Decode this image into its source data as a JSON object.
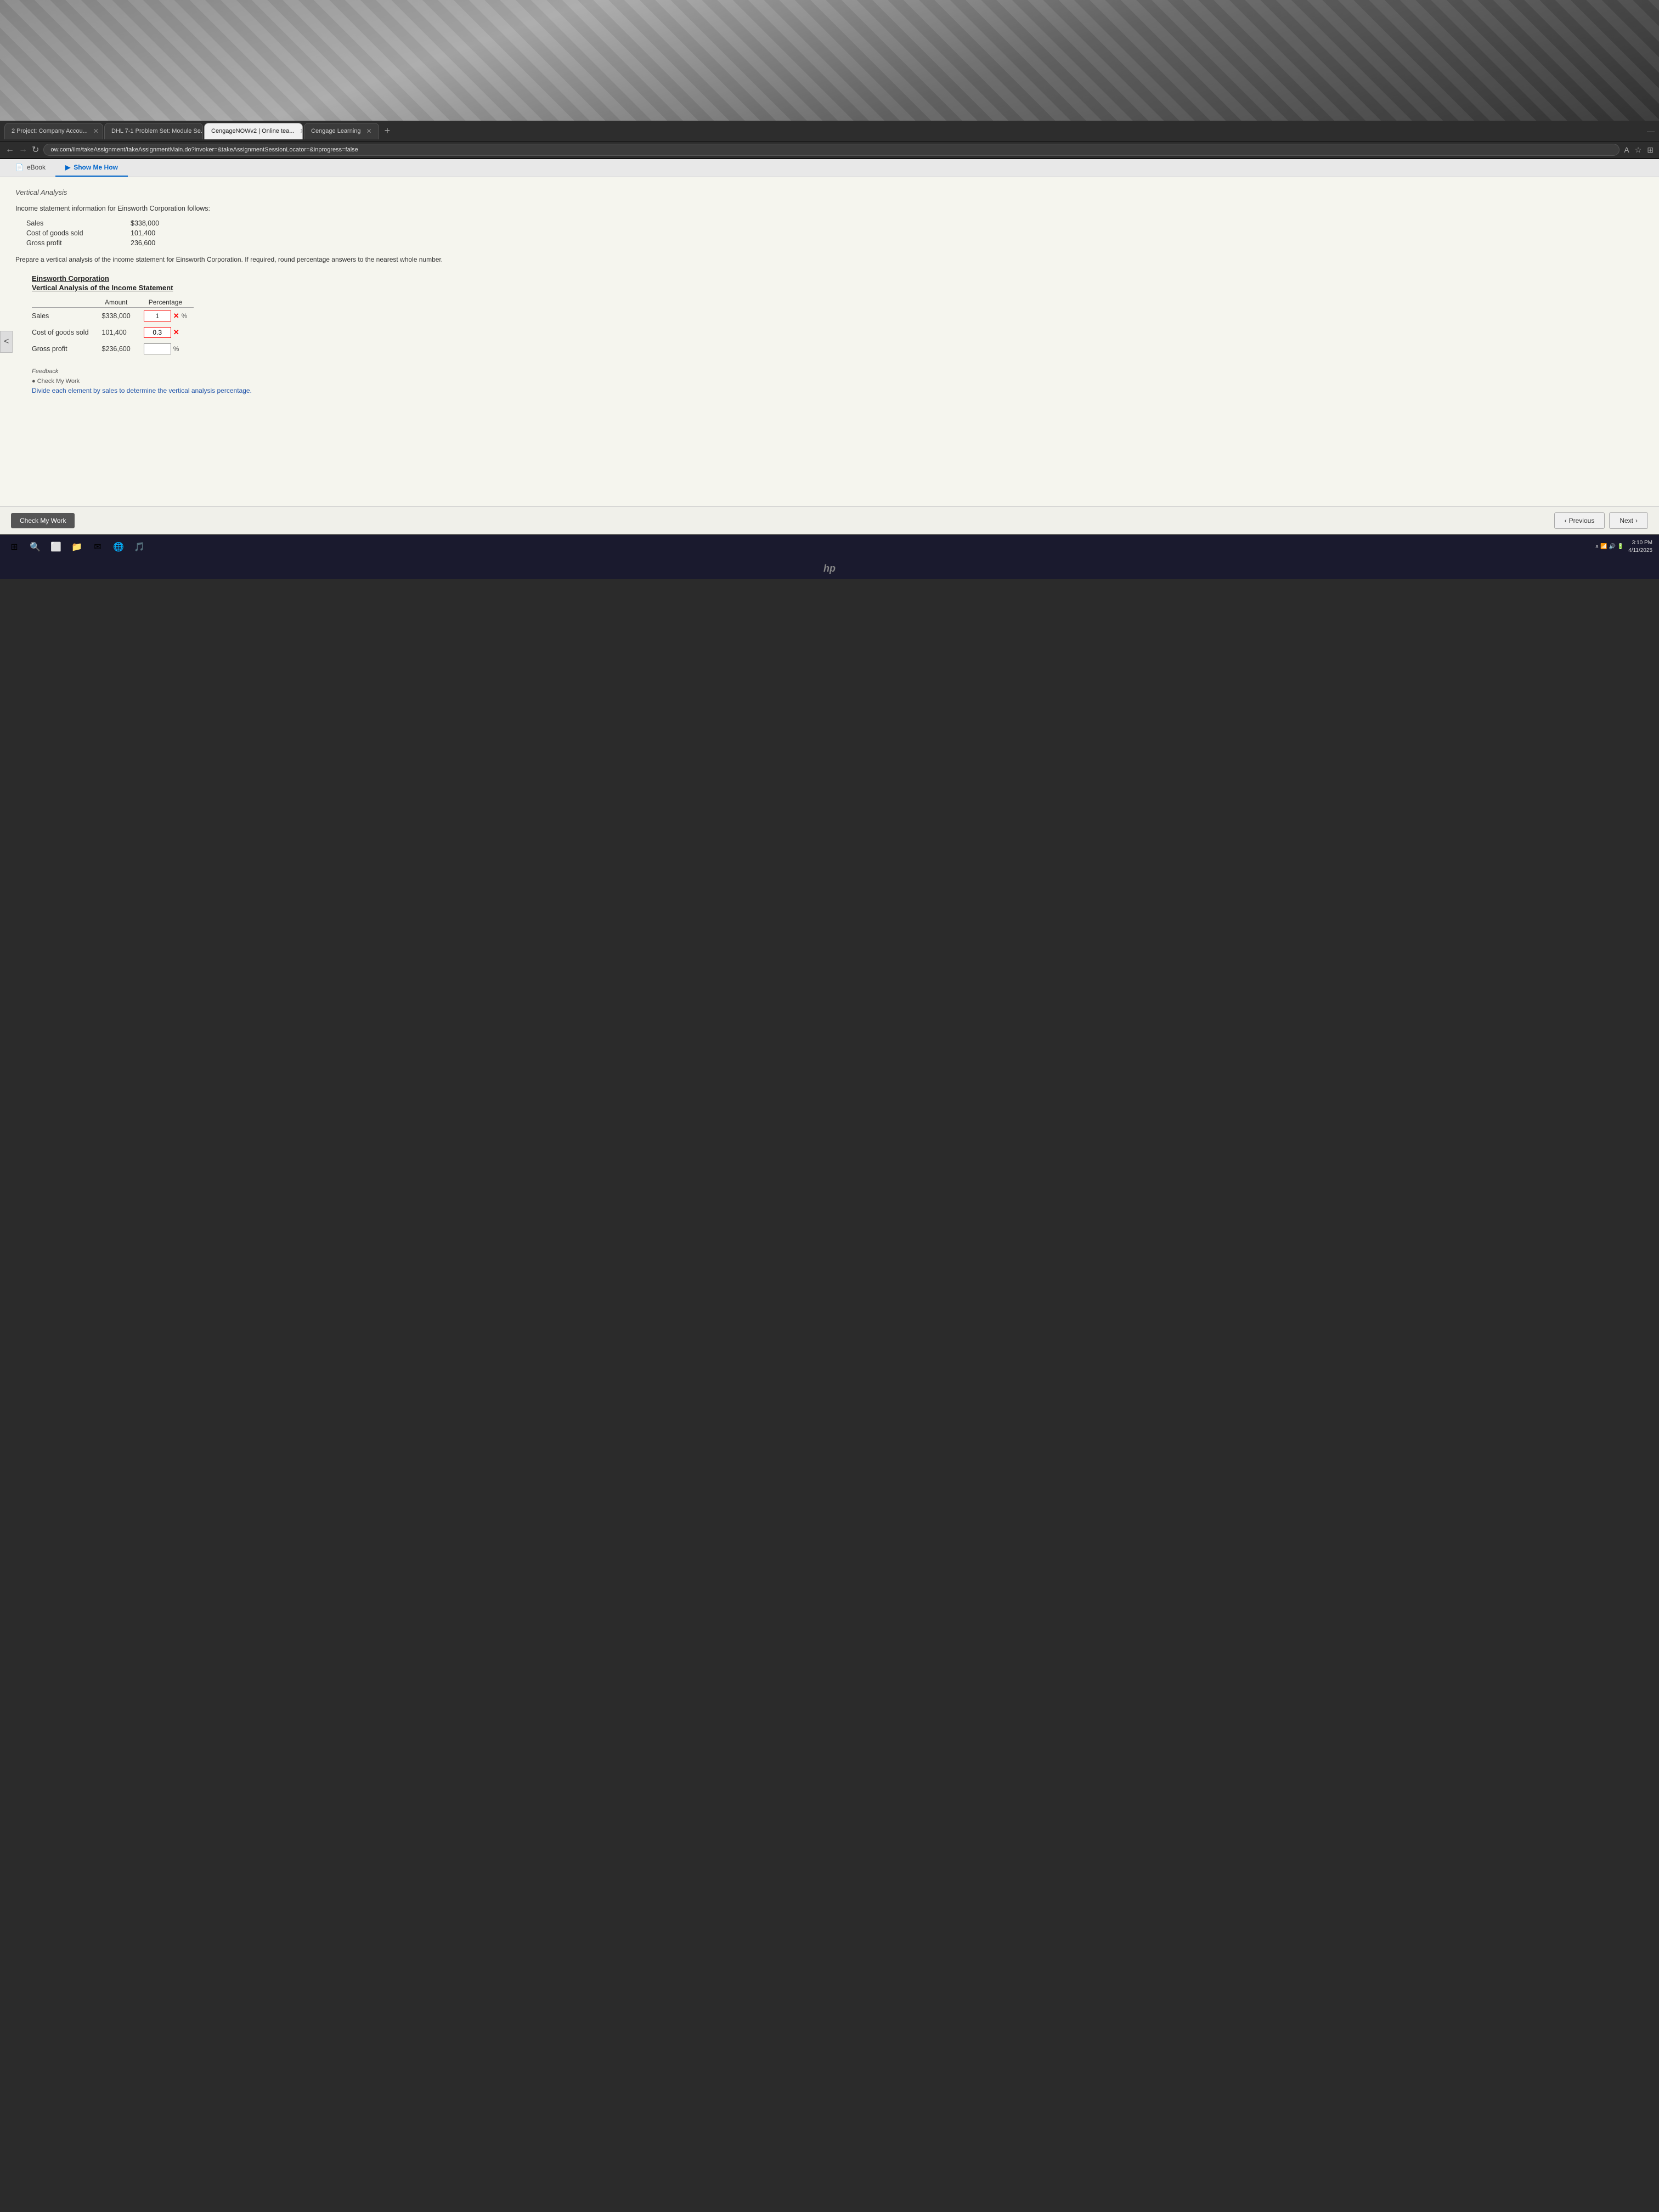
{
  "wallpaper": {
    "alt": "Plaid blanket background"
  },
  "tabs": [
    {
      "id": "tab-project",
      "label": "2 Project: Company Accou...",
      "active": false
    },
    {
      "id": "tab-problem",
      "label": "DHL 7-1 Problem Set: Module Se...",
      "active": false
    },
    {
      "id": "tab-cnow",
      "label": "CengageNOWv2 | Online tea...",
      "active": true
    },
    {
      "id": "tab-cengage",
      "label": "Cengage Learning",
      "active": false
    }
  ],
  "address_bar": {
    "url": "ow.com/ilm/takeAssignment/takeAssignmentMain.do?invoker=&takeAssignmentSessionLocator=&inprogress=false"
  },
  "content_tabs": [
    {
      "id": "ebook-tab",
      "label": "eBook",
      "icon": "📄",
      "active": false
    },
    {
      "id": "show-me-how-tab",
      "label": "Show Me How",
      "icon": "▶",
      "active": true
    }
  ],
  "section": {
    "title": "Vertical Analysis",
    "description": "Income statement information for Einsworth Corporation follows:",
    "data_rows": [
      {
        "label": "Sales",
        "value": "$338,000"
      },
      {
        "label": "Cost of goods sold",
        "value": "101,400"
      },
      {
        "label": "Gross profit",
        "value": "236,600"
      }
    ],
    "instruction": "Prepare a vertical analysis of the income statement for Einsworth Corporation. If required, round percentage answers to the nearest whole number.",
    "analysis": {
      "company": "Einsworth Corporation",
      "title": "Vertical Analysis of the Income Statement",
      "col_amount": "Amount",
      "col_percentage": "Percentage",
      "rows": [
        {
          "label": "Sales",
          "amount": "$338,000",
          "input_value": "1",
          "input_error": true,
          "suffix": "X %"
        },
        {
          "label": "Cost of goods sold",
          "amount": "101,400",
          "input_value": "0.3",
          "input_error": true,
          "suffix": "X"
        },
        {
          "label": "Gross profit",
          "amount": "$236,600",
          "input_value": "",
          "input_error": false,
          "suffix": "%"
        }
      ]
    },
    "feedback": {
      "title": "Feedback",
      "check_label": "Check My Work",
      "hint": "Divide each element by sales to determine the vertical analysis percentage."
    }
  },
  "bottom_bar": {
    "check_button": "Check My Work",
    "previous_button": "Previous",
    "next_button": "Next"
  },
  "taskbar": {
    "time": "3:10 PM",
    "date": "4/11/2025"
  }
}
